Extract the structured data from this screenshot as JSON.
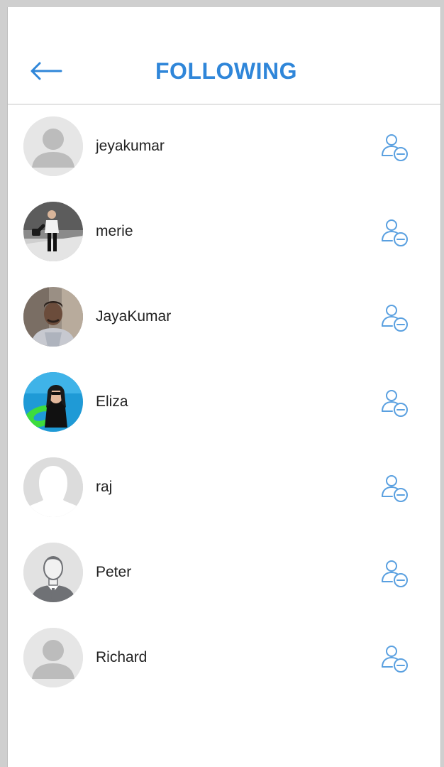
{
  "header": {
    "title": "FOLLOWING",
    "back_icon": "arrow-left-icon"
  },
  "colors": {
    "accent": "#2f86d9",
    "text": "#222222",
    "divider": "#e3e3e3"
  },
  "following": [
    {
      "name": "jeyakumar",
      "avatar": "default-avatar-icon",
      "action_icon": "remove-user-icon"
    },
    {
      "name": "merie",
      "avatar": "photo-avatar",
      "action_icon": "remove-user-icon"
    },
    {
      "name": "JayaKumar",
      "avatar": "photo-avatar",
      "action_icon": "remove-user-icon"
    },
    {
      "name": "Eliza",
      "avatar": "photo-avatar",
      "action_icon": "remove-user-icon"
    },
    {
      "name": "raj",
      "avatar": "silhouette-avatar-icon",
      "action_icon": "remove-user-icon"
    },
    {
      "name": "Peter",
      "avatar": "businessman-avatar-icon",
      "action_icon": "remove-user-icon"
    },
    {
      "name": "Richard",
      "avatar": "default-avatar-icon",
      "action_icon": "remove-user-icon"
    }
  ]
}
